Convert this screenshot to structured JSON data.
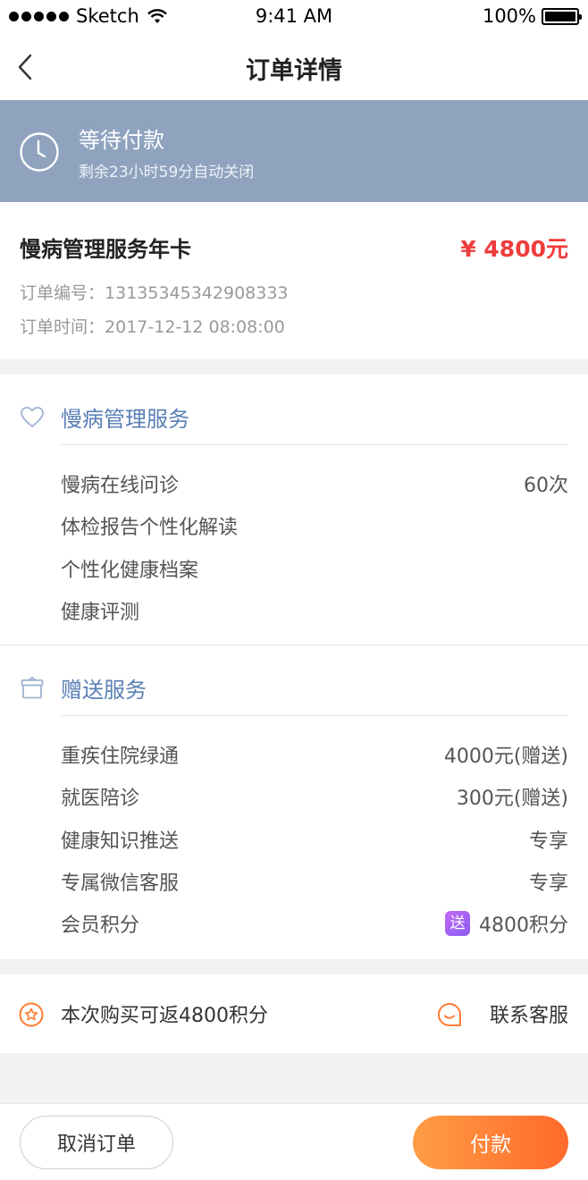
{
  "status_bar": {
    "carrier": "Sketch",
    "time": "9:41 AM",
    "battery": "100%"
  },
  "nav": {
    "title": "订单详情"
  },
  "order_status": {
    "title": "等待付款",
    "subtitle": "剩余23小时59分自动关闭"
  },
  "order": {
    "product_name": "慢病管理服务年卡",
    "price": "¥ 4800元",
    "number_label": "订单编号：",
    "number": "13135345342908333",
    "time_label": "订单时间：",
    "time": "2017-12-12   08:08:00"
  },
  "services": {
    "title": "慢病管理服务",
    "items": [
      {
        "name": "慢病在线问诊",
        "value": "60次"
      },
      {
        "name": "体检报告个性化解读",
        "value": ""
      },
      {
        "name": "个性化健康档案",
        "value": ""
      },
      {
        "name": "健康评测",
        "value": ""
      }
    ]
  },
  "gifts": {
    "title": "赠送服务",
    "items": [
      {
        "name": "重疾住院绿通",
        "value": "4000元(赠送)"
      },
      {
        "name": "就医陪诊",
        "value": "300元(赠送)"
      },
      {
        "name": "健康知识推送",
        "value": "专享"
      },
      {
        "name": "专属微信客服",
        "value": "专享"
      },
      {
        "name": "会员积分",
        "value": "4800积分",
        "badge": "送"
      }
    ]
  },
  "points": {
    "text": "本次购买可返4800积分",
    "contact": "联系客服"
  },
  "actions": {
    "cancel": "取消订单",
    "pay": "付款"
  },
  "colors": {
    "banner": "#8fa3bf",
    "accent": "#5a7fb5",
    "price": "#f03c3c",
    "orange": "#ff7a30"
  }
}
